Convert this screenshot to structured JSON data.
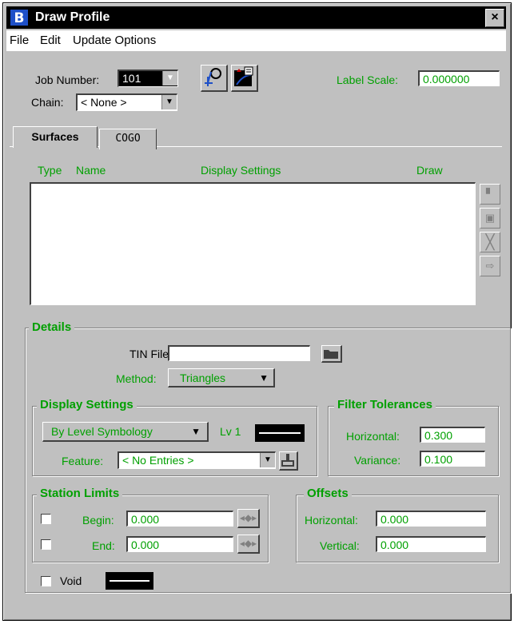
{
  "window": {
    "title": "Draw Profile",
    "close_glyph": "×"
  },
  "menu": [
    "File",
    "Edit",
    "Update Options"
  ],
  "top": {
    "job_label": "Job Number:",
    "job_value": "101",
    "chain_label": "Chain:",
    "chain_value": "< None >",
    "label_scale_label": "Label Scale:",
    "label_scale_value": "0.000000"
  },
  "tabs": [
    "Surfaces",
    "COGO"
  ],
  "surfaces": {
    "columns": [
      "Type",
      "Name",
      "Display Settings",
      "Draw"
    ],
    "rows": []
  },
  "details": {
    "title": "Details",
    "tin_label": "TIN File:",
    "tin_value": "",
    "method_label": "Method:",
    "method_value": "Triangles"
  },
  "display_settings": {
    "title": "Display Settings",
    "symbology_value": "By Level Symbology",
    "level_label": "Lv 1",
    "feature_label": "Feature:",
    "feature_value": "< No Entries >"
  },
  "filter": {
    "title": "Filter Tolerances",
    "horizontal_label": "Horizontal:",
    "horizontal_value": "0.300",
    "variance_label": "Variance:",
    "variance_value": "0.100"
  },
  "station_limits": {
    "title": "Station Limits",
    "begin_label": "Begin:",
    "begin_value": "0.000",
    "end_label": "End:",
    "end_value": "0.000"
  },
  "offsets": {
    "title": "Offsets",
    "horizontal_label": "Horizontal:",
    "horizontal_value": "0.000",
    "vertical_label": "Vertical:",
    "vertical_value": "0.000"
  },
  "void": {
    "label": "Void"
  },
  "colors": {
    "accent_green": "#00a000",
    "titlebar": "#000000",
    "face": "#c0c0c0"
  }
}
